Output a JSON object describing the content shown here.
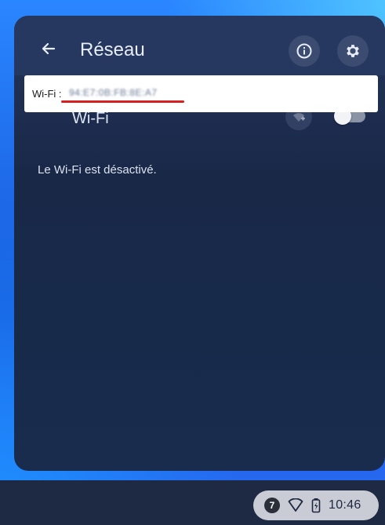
{
  "header": {
    "title": "Réseau"
  },
  "wifi": {
    "label": "Wi-Fi",
    "status_text": "Le Wi-Fi est désactivé.",
    "toggle_on": false
  },
  "mac_overlay": {
    "label": "Wi-Fi :",
    "value": "94:E7:0B:FB:8E:A7"
  },
  "status_tray": {
    "notification_count": "7",
    "time": "10:46"
  },
  "icons": {
    "back": "back-arrow-icon",
    "info": "info-icon",
    "settings": "gear-icon",
    "add_network": "add-network-icon",
    "wifi": "wifi-icon",
    "battery": "battery-charging-icon"
  },
  "colors": {
    "accent_red": "#d62020",
    "panel_bg": "#1a2848",
    "tray_bg": "#c9ccd4"
  }
}
